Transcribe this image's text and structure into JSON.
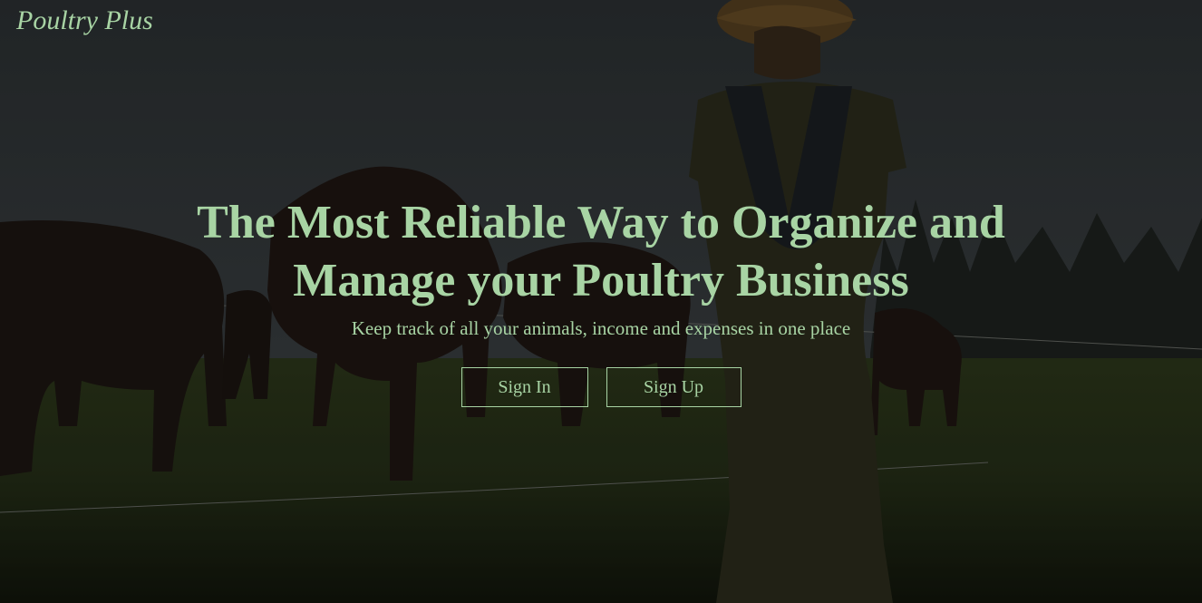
{
  "brand": {
    "name": "Poultry Plus"
  },
  "hero": {
    "headline": "The Most Reliable Way to Organize and Manage your Poultry Business",
    "subtitle": "Keep track of all your animals, income and expenses in one place"
  },
  "actions": {
    "sign_in": "Sign In",
    "sign_up": "Sign Up"
  },
  "colors": {
    "accent": "#a8d4a4",
    "overlay": "#1a1d1c"
  }
}
